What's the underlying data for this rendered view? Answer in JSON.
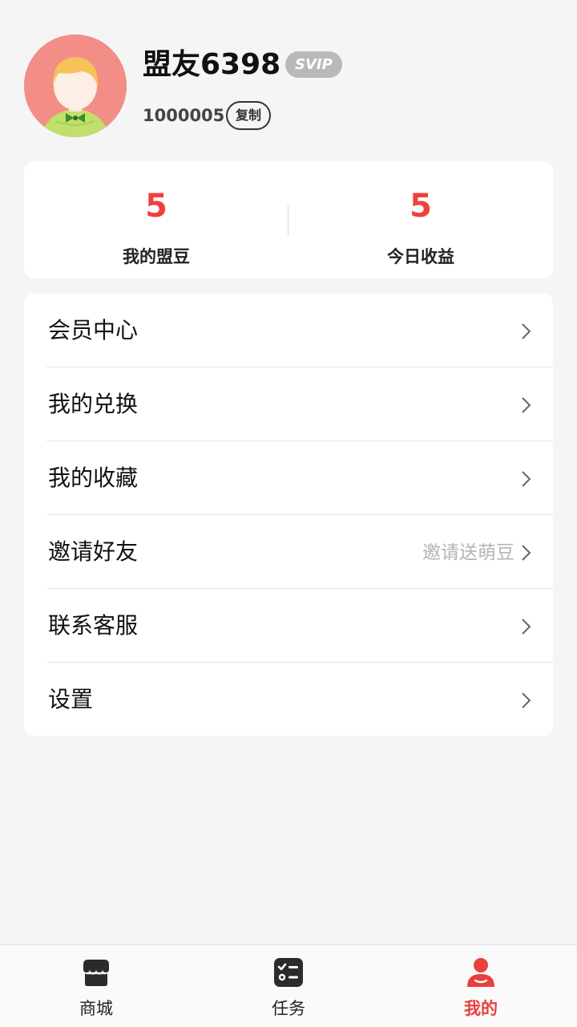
{
  "profile": {
    "nickname": "盟友6398",
    "badge": "SVIP",
    "user_id": "1000005",
    "copy_label": "复制"
  },
  "stats": [
    {
      "value": "5",
      "label": "我的盟豆"
    },
    {
      "value": "5",
      "label": "今日收益"
    }
  ],
  "menu": [
    {
      "label": "会员中心",
      "hint": ""
    },
    {
      "label": "我的兑换",
      "hint": ""
    },
    {
      "label": "我的收藏",
      "hint": ""
    },
    {
      "label": "邀请好友",
      "hint": "邀请送萌豆"
    },
    {
      "label": "联系客服",
      "hint": ""
    },
    {
      "label": "设置",
      "hint": ""
    }
  ],
  "tabbar": [
    {
      "label": "商城",
      "icon": "store-icon",
      "active": false
    },
    {
      "label": "任务",
      "icon": "task-list-icon",
      "active": false
    },
    {
      "label": "我的",
      "icon": "user-icon",
      "active": true
    }
  ],
  "colors": {
    "accent": "#e8403c",
    "stat_value": "#f0403c",
    "badge_bg": "#b9b9b9",
    "avatar_bg": "#f28e86"
  }
}
